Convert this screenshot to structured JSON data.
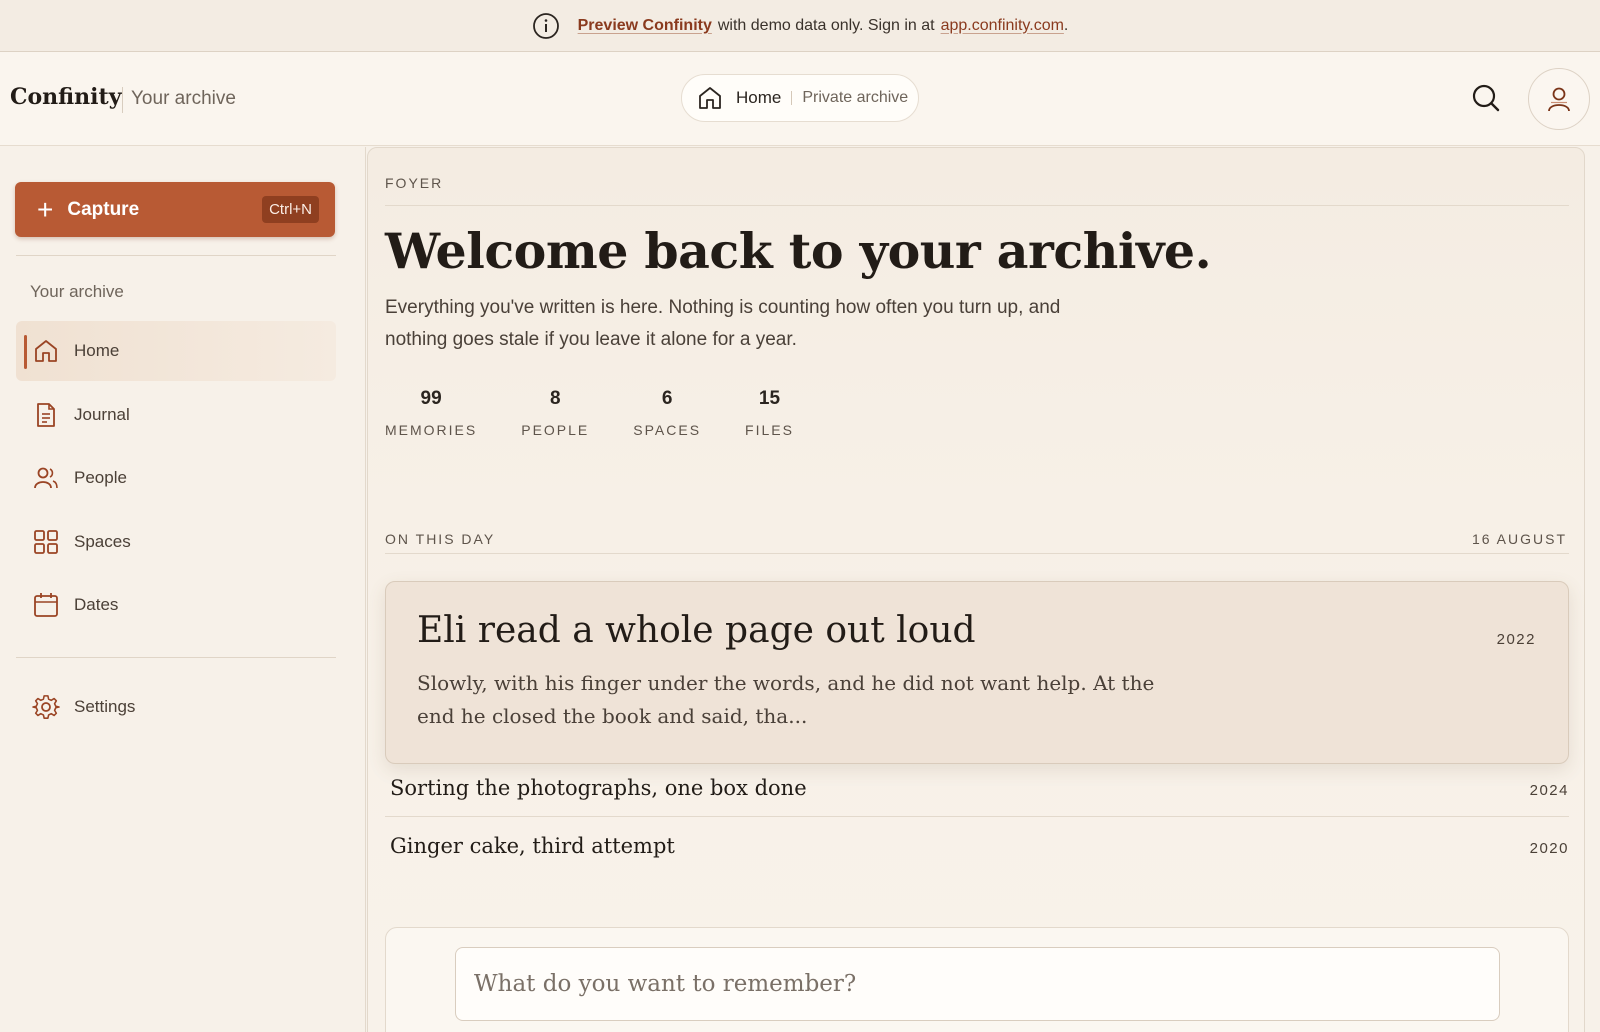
{
  "banner": {
    "link_text": "Preview Confinity",
    "middle_text": "with demo data only. Sign in at",
    "host_link": "app.confinity.com",
    "end_text": "."
  },
  "header": {
    "brand": "Confinity",
    "brand_sub": "Your archive",
    "crumb_home": "Home",
    "crumb_sub": "Private archive",
    "icons": [
      "info-icon",
      "home-icon",
      "search-icon",
      "user-icon"
    ]
  },
  "sidebar": {
    "capture_label": "Capture",
    "capture_shortcut": "Ctrl+N",
    "heading": "Your archive",
    "items": [
      {
        "label": "Home",
        "icon": "home-icon",
        "active": true
      },
      {
        "label": "Journal",
        "icon": "document-icon",
        "active": false
      },
      {
        "label": "People",
        "icon": "people-icon",
        "active": false
      },
      {
        "label": "Spaces",
        "icon": "grid-icon",
        "active": false
      },
      {
        "label": "Dates",
        "icon": "calendar-icon",
        "active": false
      }
    ],
    "settings_label": "Settings"
  },
  "main": {
    "eyebrow": "FOYER",
    "title": "Welcome back to your archive.",
    "subtitle": "Everything you've written is here. Nothing is counting how often you turn up, and nothing goes stale if you leave it alone for a year.",
    "stats": [
      {
        "value": "99",
        "label": "MEMORIES"
      },
      {
        "value": "8",
        "label": "PEOPLE"
      },
      {
        "value": "6",
        "label": "SPACES"
      },
      {
        "value": "15",
        "label": "FILES"
      }
    ],
    "on_this_day_label": "ON THIS DAY",
    "on_this_day_date": "16 AUGUST",
    "feature": {
      "title": "Eli read a whole page out loud",
      "year": "2022",
      "body": "Slowly, with his finger under the words, and he did not want help. At the end he closed the book and said, tha..."
    },
    "memories": [
      {
        "title": "Sorting the photographs, one box done",
        "year": "2024"
      },
      {
        "title": "Ginger cake, third attempt",
        "year": "2020"
      }
    ],
    "composer_placeholder": "What do you want to remember?"
  },
  "colors": {
    "accent": "#b85a34",
    "accent_dark": "#8a3a1e",
    "background": "#f7f1e9"
  }
}
